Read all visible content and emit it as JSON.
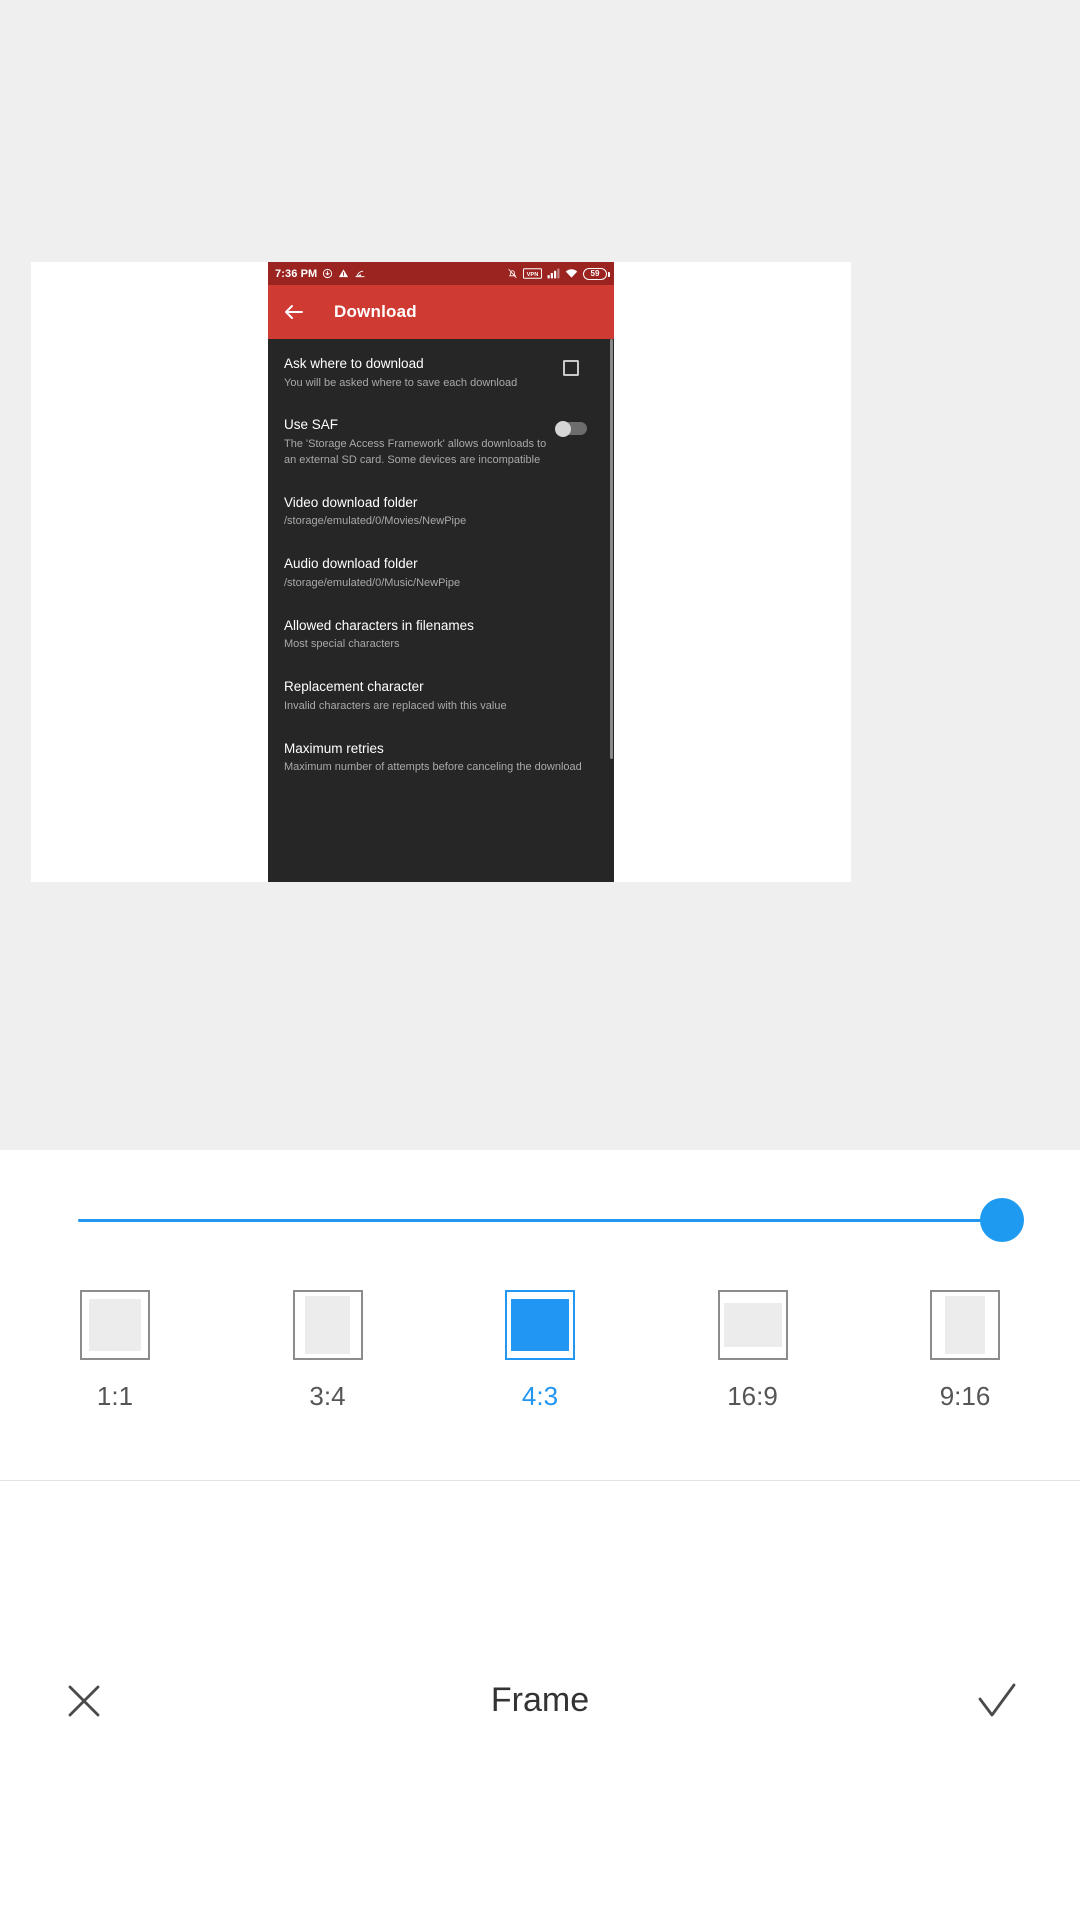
{
  "editor": {
    "tool_title": "Frame",
    "cancel_icon": "close-icon",
    "confirm_icon": "check-icon",
    "accent_color": "#2196f3",
    "slider": {
      "name": "frame-size-slider",
      "value": 100,
      "min": 0,
      "max": 100
    },
    "ratios": [
      {
        "label": "1:1",
        "selected": false,
        "inner_w": 52,
        "inner_h": 52
      },
      {
        "label": "3:4",
        "selected": false,
        "inner_w": 45,
        "inner_h": 58
      },
      {
        "label": "4:3",
        "selected": true,
        "inner_w": 58,
        "inner_h": 52
      },
      {
        "label": "16:9",
        "selected": false,
        "inner_w": 58,
        "inner_h": 44
      },
      {
        "label": "9:16",
        "selected": false,
        "inner_w": 40,
        "inner_h": 58
      }
    ]
  },
  "photo": {
    "status_bar": {
      "time": "7:36 PM",
      "left_icons": [
        "download-icon",
        "warning-icon",
        "screenshot-icon"
      ],
      "right_icons": [
        "mute-bell-icon",
        "vpn-icon",
        "signal-bars-icon",
        "wifi-icon"
      ],
      "battery_level": "59",
      "background_color": "#9c2420"
    },
    "app_bar": {
      "back_icon": "back-arrow-icon",
      "title": "Download",
      "background_color": "#cf3a33"
    },
    "preferences": [
      {
        "title": "Ask where to download",
        "summary": "You will be asked where to save each download",
        "widget": "checkbox",
        "checked": false
      },
      {
        "title": "Use SAF",
        "summary": "The 'Storage Access Framework' allows downloads to an external SD card. Some devices are incompatible",
        "widget": "switch",
        "checked": false
      },
      {
        "title": "Video download folder",
        "summary": "/storage/emulated/0/Movies/NewPipe",
        "widget": "none"
      },
      {
        "title": "Audio download folder",
        "summary": "/storage/emulated/0/Music/NewPipe",
        "widget": "none"
      },
      {
        "title": "Allowed characters in filenames",
        "summary": "Most special characters",
        "widget": "none"
      },
      {
        "title": "Replacement character",
        "summary": "Invalid characters are replaced with this value",
        "widget": "none"
      },
      {
        "title": "Maximum retries",
        "summary": "Maximum number of attempts before canceling the download",
        "widget": "none"
      }
    ]
  }
}
